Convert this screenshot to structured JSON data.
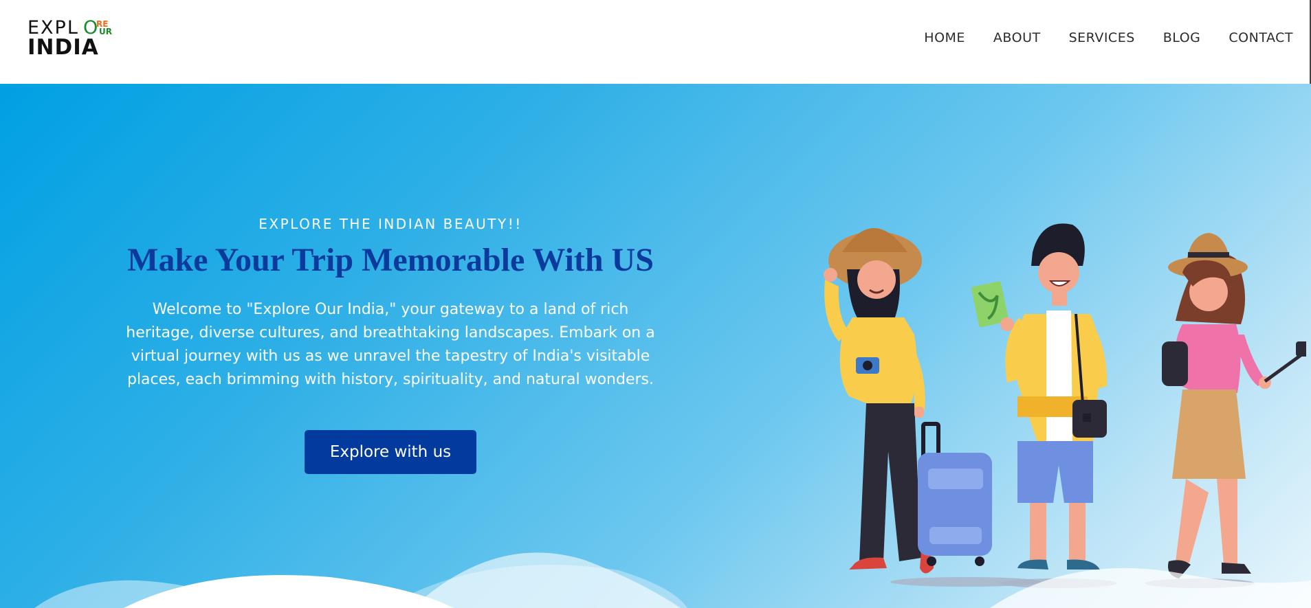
{
  "logo": {
    "line1": "EXPL",
    "o_letter": "O",
    "re": "RE",
    "ur": "UR",
    "line2": "INDIA"
  },
  "nav": [
    "HOME",
    "ABOUT",
    "SERVICES",
    "BLOG",
    "CONTACT"
  ],
  "hero": {
    "eyebrow": "EXPLORE THE INDIAN BEAUTY!!",
    "headline": "Make Your Trip Memorable With US",
    "description": "Welcome to \"Explore Our India,\" your gateway to a land of rich heritage, diverse cultures, and breathtaking landscapes. Embark on a virtual journey with us as we unravel the tapestry of India's visitable places, each brimming with history, spirituality, and natural wonders.",
    "cta_label": "Explore with us"
  },
  "colors": {
    "hero_gradient_start": "#00a0e3",
    "hero_gradient_end": "#e8f6fc",
    "headline": "#0a3a9c",
    "cta_bg": "#023b9d",
    "logo_orange": "#f26a1b",
    "logo_green": "#1a8a2a"
  },
  "illustration": {
    "name": "travelers-illustration"
  }
}
